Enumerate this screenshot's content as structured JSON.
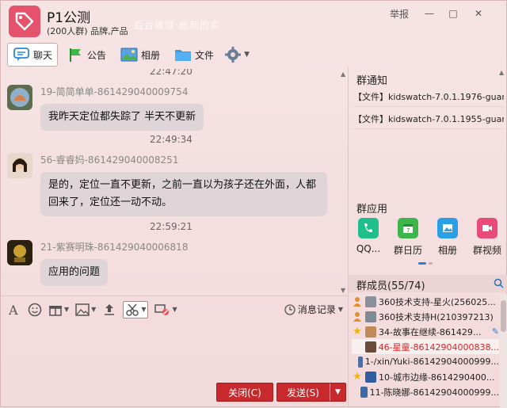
{
  "window": {
    "group_name": "P1公测",
    "group_subtitle": "(200人群) 品牌,产品",
    "watermark": "后台被隐·此刻的实",
    "report_label": "举报",
    "controls": [
      "—",
      "□",
      "✕"
    ]
  },
  "tabs": [
    {
      "label": "聊天",
      "icon": "chat-bubble-icon",
      "active": true
    },
    {
      "label": "公告",
      "icon": "flag-icon"
    },
    {
      "label": "相册",
      "icon": "photo-icon"
    },
    {
      "label": "文件",
      "icon": "folder-icon"
    }
  ],
  "chat": {
    "top_time": "22:47:20",
    "messages": [
      {
        "sender": "19-简简单单-861429040009754",
        "text": "我昨天定位都失踪了 半天不更新",
        "avatar_color": "#5d6b4e"
      },
      {
        "time": "22:49:34"
      },
      {
        "sender": "56-睿睿妈-861429040008251",
        "lines": [
          "是的，定位一直不更新，之前一直以为孩子还在外面，人都",
          "回来了，定位还一动不动。"
        ],
        "avatar_color": "#c9a48f"
      },
      {
        "time": "22:59:21"
      },
      {
        "sender": "21-紫赛明珠-861429040006818",
        "text": "应用的问题",
        "avatar_color": "#3a2a10"
      }
    ]
  },
  "toolbar": {
    "history_label": "消息记录",
    "tools": [
      "font-icon",
      "emoji-icon",
      "gift-icon",
      "image-icon",
      "upload-icon",
      "screenshot-icon",
      "poke-icon"
    ]
  },
  "actions": {
    "close_label": "关闭(C)",
    "send_label": "发送(S)"
  },
  "right_panel": {
    "notice_title": "群通知",
    "notices": [
      "【文件】kidswatch-7.0.1.1976-guan...",
      "【文件】kidswatch-7.0.1.1955-guan..."
    ],
    "apps_title": "群应用",
    "apps": [
      {
        "label": "QQ...",
        "icon": "phone-icon",
        "color": "#1fbf8c"
      },
      {
        "label": "群日历",
        "icon": "calendar-icon",
        "color": "#3cb54a"
      },
      {
        "label": "相册",
        "icon": "album-icon",
        "color": "#2a9fe3"
      },
      {
        "label": "群视频",
        "icon": "video-icon",
        "color": "#e84a7a"
      }
    ],
    "members_title": "群成员(55/74)",
    "members": [
      {
        "name": "360技术支持-星火(256025...",
        "role": "owner",
        "avatar_color": "#8a8f99"
      },
      {
        "name": "360技术支持H(210397213)",
        "role": "owner",
        "avatar_color": "#7f8a95"
      },
      {
        "name": "34-故事在继续-861429...",
        "role": "admin",
        "avatar_color": "#c08a5a",
        "edit_icon": true
      },
      {
        "name": "46-星童-86142904000838...",
        "role": "",
        "avatar_color": "#6b4a3a",
        "red": true,
        "highlight": true
      },
      {
        "name": "1-/xin/Yuki-86142904000999...",
        "role": "",
        "avatar_color": "#4a6fa8"
      },
      {
        "name": "10-城市边缘-8614290400...",
        "role": "admin",
        "avatar_color": "#2f5da0"
      },
      {
        "name": "11-陈晓娜-86142904000999...",
        "role": "",
        "avatar_color": "#3c6ca8"
      }
    ]
  },
  "colors": {
    "accent_red": "#c7292c",
    "bubble": "#dfd5d9",
    "background": "#f3dcdd"
  }
}
